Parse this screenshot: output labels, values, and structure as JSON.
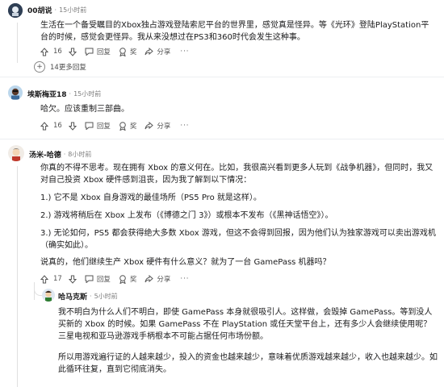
{
  "comments": [
    {
      "user": "00胡说",
      "sep": "·",
      "time": "15小时前",
      "text": "生活在一个备受瞩目的Xbox独占游戏登陆索尼平台的世界里，感觉真是怪异。等《光环》登陆PlayStation平台的时候，感觉会更怪异。我从来没想过在PS3和360时代会发生这种事。",
      "votes": "16",
      "reply": "回复",
      "award": "奖",
      "share": "分享",
      "more": "···",
      "more_replies": "14更多回复"
    },
    {
      "user": "埃斯梅亚18",
      "sep": "·",
      "time": "15小时前",
      "text": "哈欠。应该重制三部曲。",
      "votes": "16",
      "reply": "回复",
      "award": "奖",
      "share": "分享",
      "more": "···"
    },
    {
      "user": "汤米-哈德",
      "sep": "·",
      "time": "8小时前",
      "p1": "你真的不得不思考。现在拥有 Xbox 的意义何在。比如，我很高兴看到更多人玩到《战争机器》，但同时，我又对自己投资 Xbox 硬件感到沮丧，因为我了解到以下情况：",
      "p2": "1.) 它不是 Xbox 自身游戏的最佳场所（PS5 Pro 就是这样）。",
      "p3": "2.) 游戏将稍后在 Xbox 上发布（《博德之门 3》）或根本不发布（《黑神话悟空》）。",
      "p4": "3.) 无论如何，PS5 都会获得绝大多数 Xbox 游戏，但这不会得到回报，因为他们认为独家游戏可以卖出游戏机（确实如此）。",
      "p5": "说真的，他们继续生产 Xbox 硬件有什么意义？就为了一台 GamePass 机器吗？",
      "votes": "17",
      "reply": "回复",
      "award": "奖",
      "share": "分享",
      "more": "···"
    },
    {
      "user": "哈马克斯",
      "sep": "·",
      "time": "5小时前",
      "p1": "我不明白为什么人们不明白，即使 GamePass 本身就很吸引人。这样做，会毁掉 GamePass。等到没人买新的 Xbox 的时候。如果 GamePass 不在 PlayStation 或任天堂平台上，还有多少人会继续使用呢？三星电视和亚马逊游戏手柄根本不可能占据任何市场份额。",
      "p2": "所以用游戏遍行证的人越来越少，投入的资金也越来越少，意味着优质游戏越来越少，收入也越来越少。如此循环往复，直到它彻底消失。"
    }
  ]
}
